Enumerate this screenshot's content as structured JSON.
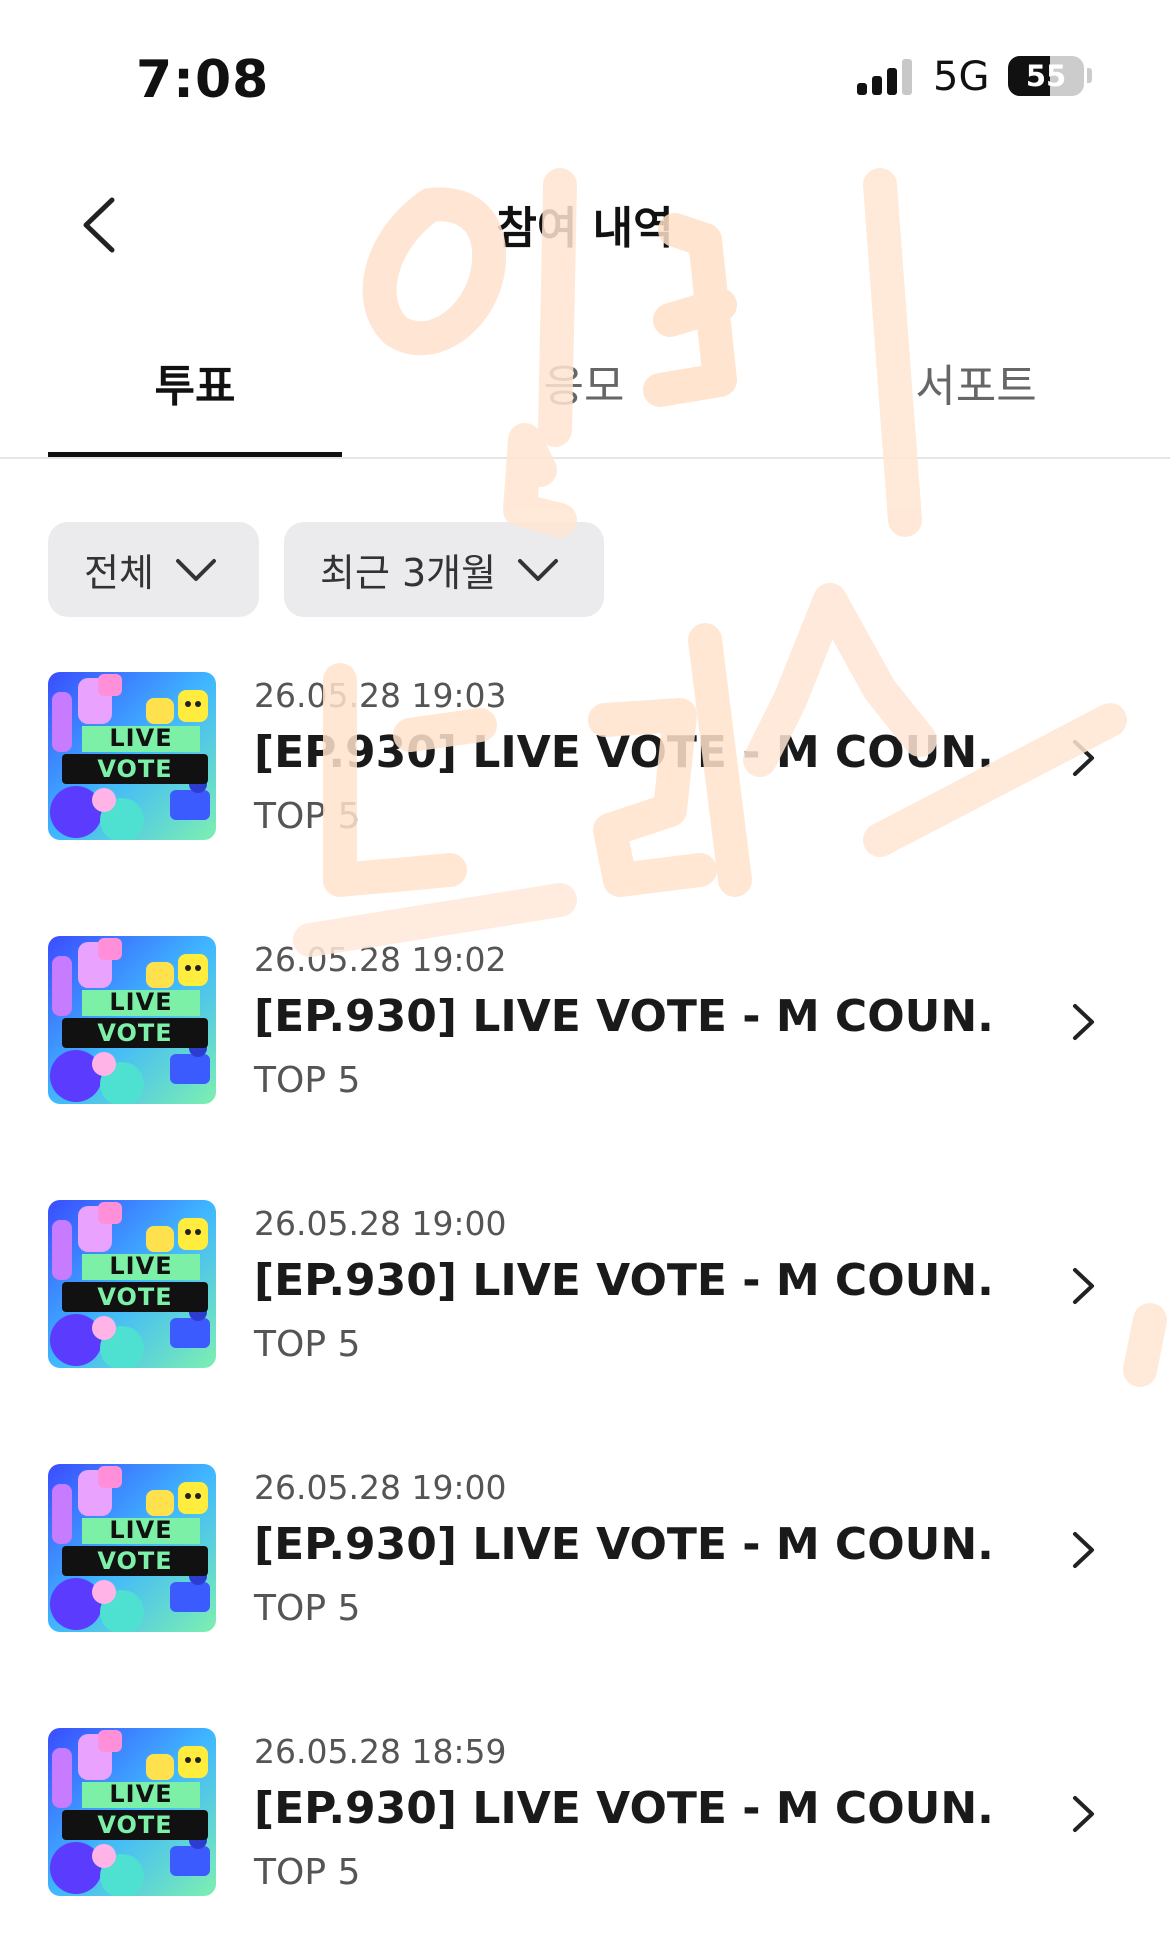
{
  "status_bar": {
    "time": "7:08",
    "network": "5G",
    "battery": "55"
  },
  "header": {
    "title": "참여 내역"
  },
  "tabs": [
    {
      "label": "투표",
      "active": true
    },
    {
      "label": "응모",
      "active": false
    },
    {
      "label": "서포트",
      "active": false
    }
  ],
  "filters": {
    "type": "전체",
    "period": "최근 3개월"
  },
  "thumbnail": {
    "line1": "LIVE",
    "line2": "VOTE"
  },
  "items": [
    {
      "date": "26.05.28 19:03",
      "title": "[EP.930] LIVE VOTE - M COUN...",
      "subtitle": "TOP 5"
    },
    {
      "date": "26.05.28 19:02",
      "title": "[EP.930] LIVE VOTE - M COUN...",
      "subtitle": "TOP 5"
    },
    {
      "date": "26.05.28 19:00",
      "title": "[EP.930] LIVE VOTE - M COUN...",
      "subtitle": "TOP 5"
    },
    {
      "date": "26.05.28 19:00",
      "title": "[EP.930] LIVE VOTE - M COUN...",
      "subtitle": "TOP 5"
    },
    {
      "date": "26.05.28 18:59",
      "title": "[EP.930] LIVE VOTE - M COUN...",
      "subtitle": "TOP 5"
    }
  ],
  "colors": {
    "accent": "#111111",
    "watermark": "#ffb27a"
  }
}
